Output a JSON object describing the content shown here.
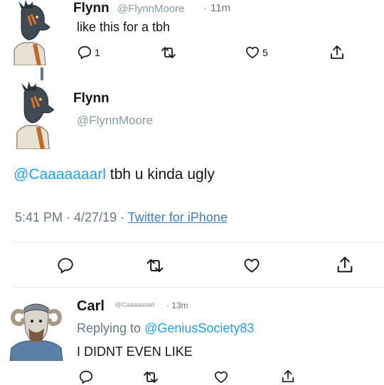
{
  "tweets": [
    {
      "name": "Flynn",
      "handle": "@FlynnMoore",
      "separator": "·",
      "time": "11m",
      "text": "like this for a tbh",
      "reply_count": "1",
      "like_count": "5"
    },
    {
      "name": "Flynn",
      "handle": "@FlynnMoore",
      "mention": "@Caaaaaaarl",
      "text": " tbh u kinda ugly",
      "meta_prefix": "5:41 PM · 4/27/19 · ",
      "source": "Twitter for iPhone"
    },
    {
      "name": "Carl",
      "handle": "@Caaaaaaarl",
      "time": "· 13m",
      "replying_prefix": "Replying to ",
      "replying_to": "@GeniusSociety83",
      "text": "I DIDNT EVEN LIKE"
    }
  ],
  "icons": [
    "reply-icon",
    "retweet-icon",
    "like-icon",
    "share-icon"
  ],
  "colors": {
    "link": "#1da1f2",
    "muted": "#657786",
    "text": "#14171a",
    "divider": "#e1e8ed"
  }
}
